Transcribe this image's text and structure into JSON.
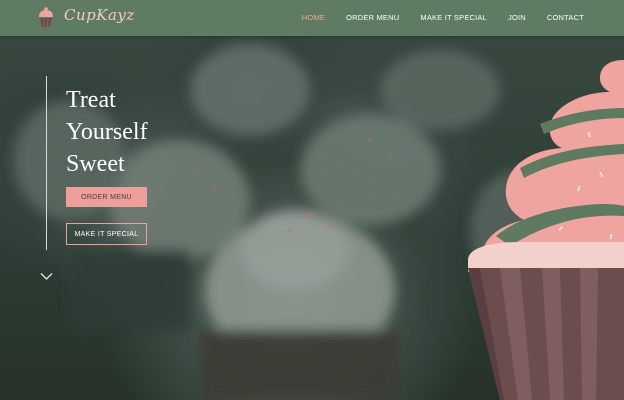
{
  "brand": {
    "name": "CupKayz",
    "logo_icon": "cupcake-icon"
  },
  "nav": {
    "items": [
      {
        "label": "HOME",
        "active": true
      },
      {
        "label": "ORDER MENU",
        "active": false
      },
      {
        "label": "MAKE IT SPECIAL",
        "active": false
      },
      {
        "label": "JOIN",
        "active": false
      },
      {
        "label": "CONTACT",
        "active": false
      }
    ]
  },
  "hero": {
    "title_lines": [
      "Treat",
      "Yourself",
      "Sweet"
    ],
    "primary_button": "ORDER MENU",
    "secondary_button": "MAKE IT SPECIAL",
    "scroll_icon": "chevron-down-icon"
  },
  "colors": {
    "nav_bg": "#5f7c62",
    "accent_pink": "#ee9f9b",
    "active_nav": "#f1a5a0",
    "frosting_stripe": "#5e7a60",
    "cup_brown": "#6b4d4e"
  }
}
